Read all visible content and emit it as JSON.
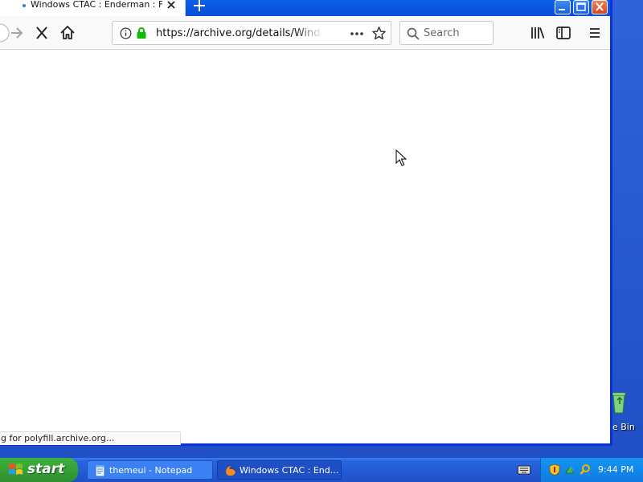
{
  "browser": {
    "tab": {
      "title": "Windows CTAC : Enderman : Free"
    },
    "url": "https://archive.org/details/Windows",
    "search": {
      "placeholder": "Search"
    },
    "status_text": "g for polyfill.archive.org..."
  },
  "desktop": {
    "recycle_bin_label": "e Bin"
  },
  "taskbar": {
    "start_label": "start",
    "tasks": [
      {
        "label": "themeui - Notepad",
        "icon": "notepad-icon"
      },
      {
        "label": "Windows CTAC : End...",
        "icon": "firefox-icon"
      }
    ],
    "clock": "9:44 PM"
  },
  "colors": {
    "title_blue": "#0a5fe8",
    "taskbar_blue": "#245dd8",
    "start_green": "#3cb23c",
    "tray_blue": "#1594f2",
    "secure_lock_green": "#12bc00"
  }
}
